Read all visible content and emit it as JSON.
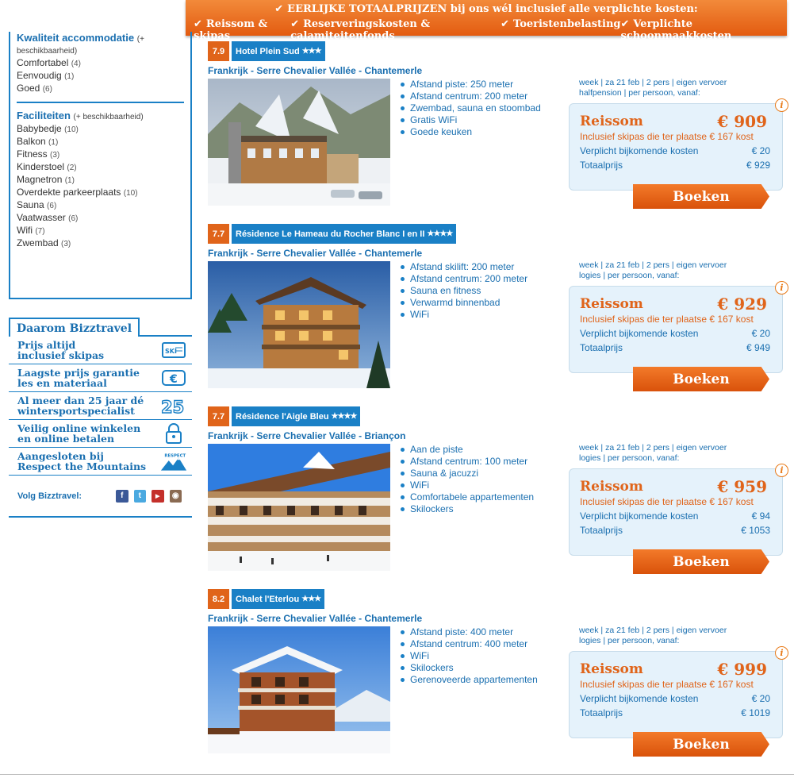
{
  "banner": {
    "headline": "EERLIJKE TOTAALPRIJZEN bij ons wél inclusief alle verplichte kosten:",
    "items": [
      "Reissom & skipas",
      "Reserveringskosten & calamiteitenfonds",
      "Toeristenbelasting",
      "Verplichte schoonmaakkosten"
    ]
  },
  "sidebar": {
    "kwaliteit": {
      "title": "Kwaliteit accommodatie",
      "note": "(+ beschikbaarheid)",
      "items": [
        {
          "label": "Comfortabel",
          "count": "(4)"
        },
        {
          "label": "Eenvoudig",
          "count": "(1)"
        },
        {
          "label": "Goed",
          "count": "(6)"
        }
      ]
    },
    "faciliteiten": {
      "title": "Faciliteiten",
      "note": "(+ beschikbaarheid)",
      "items": [
        {
          "label": "Babybedje",
          "count": "(10)"
        },
        {
          "label": "Balkon",
          "count": "(1)"
        },
        {
          "label": "Fitness",
          "count": "(3)"
        },
        {
          "label": "Kinderstoel",
          "count": "(2)"
        },
        {
          "label": "Magnetron",
          "count": "(1)"
        },
        {
          "label": "Overdekte parkeerplaats",
          "count": "(10)"
        },
        {
          "label": "Sauna",
          "count": "(6)"
        },
        {
          "label": "Vaatwasser",
          "count": "(6)"
        },
        {
          "label": "Wifi",
          "count": "(7)"
        },
        {
          "label": "Zwembad",
          "count": "(3)"
        }
      ]
    },
    "why": {
      "title": "Daarom Bizztravel",
      "items": [
        {
          "line1": "Prijs altijd",
          "line2": "inclusief skipas",
          "icon": "ski-pass-icon"
        },
        {
          "line1": "Laagste prijs garantie",
          "line2": "les en materiaal",
          "icon": "euro-icon"
        },
        {
          "line1": "Al meer dan 25 jaar dé",
          "line2": "wintersportspecialist",
          "icon": "25-years-icon"
        },
        {
          "line1": "Veilig online winkelen",
          "line2": "en online betalen",
          "icon": "lock-icon"
        },
        {
          "line1": "Aangesloten bij",
          "line2": "Respect the Mountains",
          "icon": "respect-mountains-icon"
        }
      ],
      "social_label": "Volg Bizztravel:",
      "respect_badge": "RESPECT"
    }
  },
  "listings": [
    {
      "score": "7.9",
      "name": "Hotel Plein Sud",
      "stars": "★★★",
      "location": "Frankrijk - Serre Chevalier Vallée - Chantemerle",
      "features": [
        "Afstand piste: 250 meter",
        "Afstand centrum: 200 meter",
        "Zwembad, sauna en stoombad",
        "Gratis WiFi",
        "Goede keuken"
      ],
      "meta1": "week | za 21 feb | 2 pers | eigen vervoer",
      "meta2": "halfpension | per persoon, vanaf:",
      "label": "Reissom",
      "price": "€ 909",
      "skipas": "Inclusief skipas die ter plaatse € 167 kost",
      "extra_label": "Verplicht bijkomende kosten",
      "extra": "€ 20",
      "total_label": "Totaalprijs",
      "total": "€ 929",
      "button": "Boeken"
    },
    {
      "score": "7.7",
      "name": "Résidence Le Hameau du Rocher Blanc I en II",
      "stars": "★★★★",
      "location": "Frankrijk - Serre Chevalier Vallée - Chantemerle",
      "features": [
        "Afstand skilift: 200 meter",
        "Afstand centrum: 200 meter",
        "Sauna en fitness",
        "Verwarmd binnenbad",
        "WiFi"
      ],
      "meta1": "week | za 21 feb | 2 pers | eigen vervoer",
      "meta2": "logies | per persoon, vanaf:",
      "label": "Reissom",
      "price": "€ 929",
      "skipas": "Inclusief skipas die ter plaatse € 167 kost",
      "extra_label": "Verplicht bijkomende kosten",
      "extra": "€ 20",
      "total_label": "Totaalprijs",
      "total": "€ 949",
      "button": "Boeken"
    },
    {
      "score": "7.7",
      "name": "Résidence l'Aigle Bleu",
      "stars": "★★★★",
      "location": "Frankrijk - Serre Chevalier Vallée - Briançon",
      "features": [
        "Aan de piste",
        "Afstand centrum: 100 meter",
        "Sauna & jacuzzi",
        "WiFi",
        "Comfortabele appartementen",
        "Skilockers"
      ],
      "meta1": "week | za 21 feb | 2 pers | eigen vervoer",
      "meta2": "logies | per persoon, vanaf:",
      "label": "Reissom",
      "price": "€ 959",
      "skipas": "Inclusief skipas die ter plaatse € 167 kost",
      "extra_label": "Verplicht bijkomende kosten",
      "extra": "€ 94",
      "total_label": "Totaalprijs",
      "total": "€ 1053",
      "button": "Boeken"
    },
    {
      "score": "8.2",
      "name": "Chalet l'Eterlou",
      "stars": "★★★",
      "location": "Frankrijk - Serre Chevalier Vallée - Chantemerle",
      "features": [
        "Afstand piste: 400 meter",
        "Afstand centrum: 400 meter",
        "WiFi",
        "Skilockers",
        "Gerenoveerde appartementen"
      ],
      "meta1": "week | za 21 feb | 2 pers | eigen vervoer",
      "meta2": "logies | per persoon, vanaf:",
      "label": "Reissom",
      "price": "€ 999",
      "skipas": "Inclusief skipas die ter plaatse € 167 kost",
      "extra_label": "Verplicht bijkomende kosten",
      "extra": "€ 20",
      "total_label": "Totaalprijs",
      "total": "€ 1019",
      "button": "Boeken"
    }
  ],
  "colors": {
    "brand_blue": "#1a80c6",
    "accent_orange": "#e0641a",
    "price_bg": "#e5f2fb"
  }
}
